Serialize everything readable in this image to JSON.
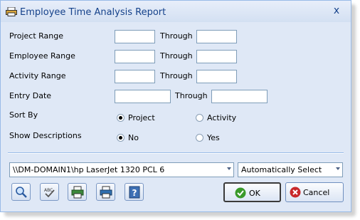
{
  "window": {
    "title": "Employee Time Analysis Report",
    "close_glyph": "x"
  },
  "ranges": {
    "project_label": "Project Range",
    "employee_label": "Employee Range",
    "activity_label": "Activity Range",
    "through_label": "Through",
    "project_from": "",
    "project_to": "",
    "employee_from": "",
    "employee_to": "",
    "activity_from": "",
    "activity_to": ""
  },
  "entry_date": {
    "label": "Entry Date",
    "through_label": "Through",
    "from": "",
    "to": ""
  },
  "sort_by": {
    "label": "Sort By",
    "options": [
      "Project",
      "Activity"
    ],
    "selected": "Project"
  },
  "show_descriptions": {
    "label": "Show Descriptions",
    "options": [
      "No",
      "Yes"
    ],
    "selected": "No"
  },
  "printer": {
    "value": "\\\\DM-DOMAIN1\\hp LaserJet 1320 PCL 6"
  },
  "tray": {
    "value": "Automatically Select"
  },
  "toolbar": {
    "icons": [
      "preview-icon",
      "spellcheck-icon",
      "print-setup-icon",
      "print-icon",
      "help-icon"
    ]
  },
  "buttons": {
    "ok_label": "OK",
    "cancel_label": "Cancel"
  },
  "colors": {
    "dialog_bg": "#dfe8f6",
    "title_text": "#15428b",
    "ok_green": "#3a9a2a",
    "cancel_red": "#c8282a"
  }
}
